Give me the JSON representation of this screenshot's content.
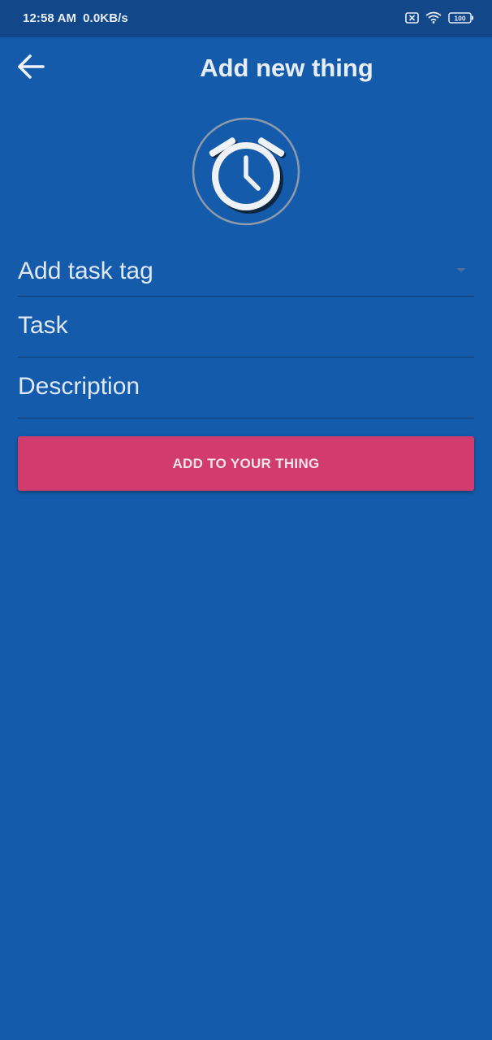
{
  "status_bar": {
    "time": "12:58 AM",
    "net_speed": "0.0KB/s",
    "battery": "100",
    "icons": [
      "sim-off-icon",
      "wifi-icon",
      "battery-icon"
    ]
  },
  "app_bar": {
    "title": "Add new thing",
    "back_icon": "arrow-back-icon"
  },
  "logo": {
    "icon": "alarm-clock-icon"
  },
  "form": {
    "tag_placeholder": "Add task tag",
    "task_placeholder": "Task",
    "description_placeholder": "Description",
    "submit_label": "ADD TO YOUR THING"
  },
  "colors": {
    "background": "#145bab",
    "status_bar": "#12478a",
    "accent_button": "#d23b6e",
    "divider": "#0c3a75"
  }
}
